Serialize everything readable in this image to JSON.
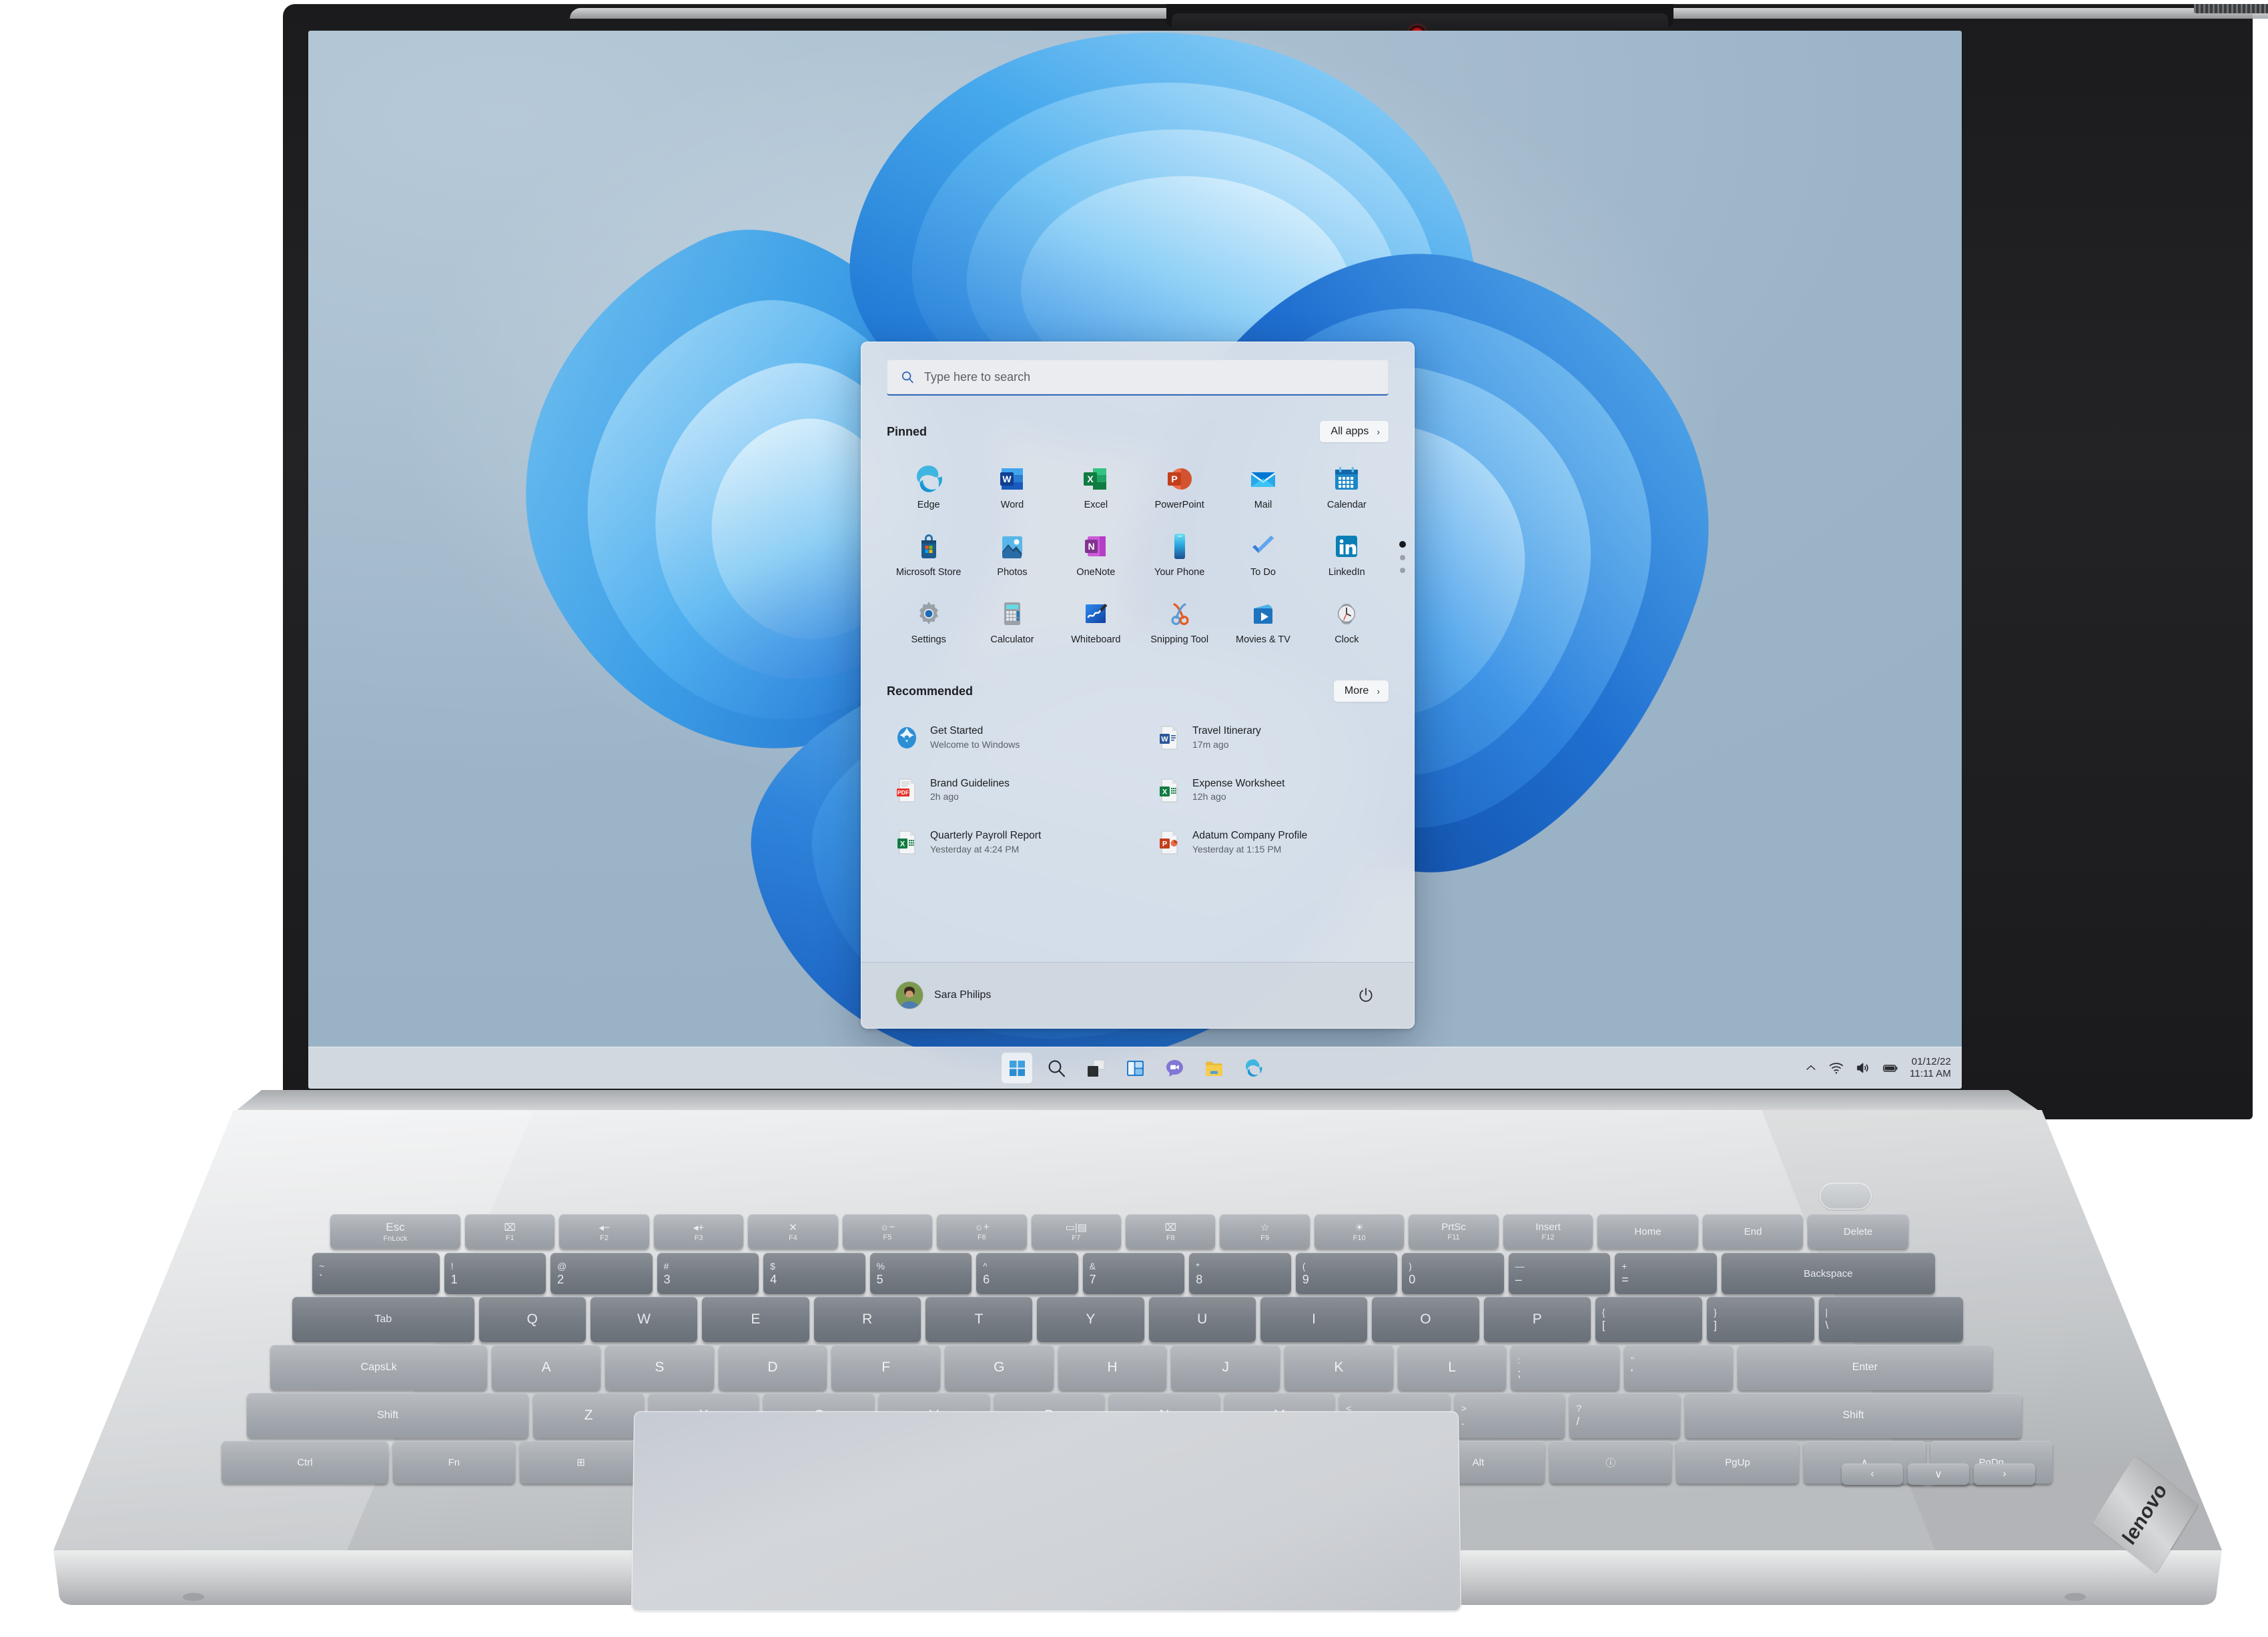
{
  "device": {
    "brand": "lenovo",
    "camera_icon": "webcam-icon"
  },
  "desktop": {
    "wallpaper_name": "windows-11-bloom"
  },
  "start_menu": {
    "search": {
      "placeholder": "Type here to search",
      "value": "",
      "icon": "search-icon"
    },
    "pinned": {
      "title": "Pinned",
      "all_apps_label": "All apps",
      "chevron": "›",
      "pages": {
        "count": 3,
        "current": 1
      },
      "apps": [
        {
          "label": "Edge",
          "icon": "edge-icon"
        },
        {
          "label": "Word",
          "icon": "word-icon"
        },
        {
          "label": "Excel",
          "icon": "excel-icon"
        },
        {
          "label": "PowerPoint",
          "icon": "powerpoint-icon"
        },
        {
          "label": "Mail",
          "icon": "mail-icon"
        },
        {
          "label": "Calendar",
          "icon": "calendar-icon"
        },
        {
          "label": "Microsoft Store",
          "icon": "microsoft-store-icon"
        },
        {
          "label": "Photos",
          "icon": "photos-icon"
        },
        {
          "label": "OneNote",
          "icon": "onenote-icon"
        },
        {
          "label": "Your Phone",
          "icon": "your-phone-icon"
        },
        {
          "label": "To Do",
          "icon": "to-do-icon"
        },
        {
          "label": "LinkedIn",
          "icon": "linkedin-icon"
        },
        {
          "label": "Settings",
          "icon": "settings-gear-icon"
        },
        {
          "label": "Calculator",
          "icon": "calculator-icon"
        },
        {
          "label": "Whiteboard",
          "icon": "whiteboard-icon"
        },
        {
          "label": "Snipping Tool",
          "icon": "snipping-tool-icon"
        },
        {
          "label": "Movies & TV",
          "icon": "movies-tv-icon"
        },
        {
          "label": "Clock",
          "icon": "clock-icon"
        }
      ]
    },
    "recommended": {
      "title": "Recommended",
      "more_label": "More",
      "chevron": "›",
      "items": [
        {
          "title": "Get Started",
          "subtitle": "Welcome to Windows",
          "icon": "get-started-icon"
        },
        {
          "title": "Travel Itinerary",
          "subtitle": "17m ago",
          "icon": "word-doc-icon"
        },
        {
          "title": "Brand Guidelines",
          "subtitle": "2h ago",
          "icon": "pdf-doc-icon"
        },
        {
          "title": "Expense Worksheet",
          "subtitle": "12h ago",
          "icon": "excel-doc-icon"
        },
        {
          "title": "Quarterly Payroll Report",
          "subtitle": "Yesterday at 4:24 PM",
          "icon": "excel-doc-icon"
        },
        {
          "title": "Adatum Company Profile",
          "subtitle": "Yesterday at 1:15 PM",
          "icon": "powerpoint-doc-icon"
        }
      ]
    },
    "footer": {
      "user_name": "Sara Philips",
      "avatar": "user-avatar",
      "power_icon": "power-icon"
    }
  },
  "taskbar": {
    "buttons": [
      {
        "name": "start-button",
        "icon": "windows-logo-icon",
        "active": true
      },
      {
        "name": "search-button",
        "icon": "search-icon",
        "active": false
      },
      {
        "name": "task-view-button",
        "icon": "task-view-icon",
        "active": false
      },
      {
        "name": "widgets-button",
        "icon": "widgets-icon",
        "active": false
      },
      {
        "name": "chat-button",
        "icon": "chat-icon",
        "active": false
      },
      {
        "name": "file-explorer-button",
        "icon": "folder-icon",
        "active": false
      },
      {
        "name": "edge-button",
        "icon": "edge-icon",
        "active": false
      }
    ],
    "tray": {
      "overflow_icon": "chevron-up-icon",
      "wifi_icon": "wifi-icon",
      "volume_icon": "speaker-icon",
      "battery_icon": "battery-icon",
      "date": "01/12/22",
      "time": "11:11 AM"
    }
  },
  "keyboard": {
    "function_row": [
      {
        "top": "Esc",
        "bottom": "FnLock"
      },
      {
        "top": "⌧",
        "bottom": "F1"
      },
      {
        "top": "◂−",
        "bottom": "F2"
      },
      {
        "top": "◂+",
        "bottom": "F3"
      },
      {
        "top": "✕",
        "bottom": "F4"
      },
      {
        "top": "☼−",
        "bottom": "F5"
      },
      {
        "top": "☼+",
        "bottom": "F6"
      },
      {
        "top": "▭|▤",
        "bottom": "F7"
      },
      {
        "top": "⌧",
        "bottom": "F8"
      },
      {
        "top": "☆",
        "bottom": "F9"
      },
      {
        "top": "☀",
        "bottom": "F10"
      },
      {
        "top": "PrtSc",
        "bottom": "F11"
      },
      {
        "top": "Insert",
        "bottom": "F12"
      },
      {
        "top": "Home",
        "bottom": ""
      },
      {
        "top": "End",
        "bottom": ""
      },
      {
        "top": "Delete",
        "bottom": ""
      }
    ],
    "number_row": [
      {
        "up": "~",
        "low": "`"
      },
      {
        "up": "!",
        "low": "1"
      },
      {
        "up": "@",
        "low": "2"
      },
      {
        "up": "#",
        "low": "3"
      },
      {
        "up": "$",
        "low": "4"
      },
      {
        "up": "%",
        "low": "5"
      },
      {
        "up": "^",
        "low": "6"
      },
      {
        "up": "&",
        "low": "7"
      },
      {
        "up": "*",
        "low": "8"
      },
      {
        "up": "(",
        "low": "9"
      },
      {
        "up": ")",
        "low": "0"
      },
      {
        "up": "—",
        "low": "–"
      },
      {
        "up": "+",
        "low": "="
      },
      {
        "up": "",
        "low": "Backspace"
      }
    ],
    "row_q": [
      "Tab",
      "Q",
      "W",
      "E",
      "R",
      "T",
      "Y",
      "U",
      "I",
      "O",
      "P",
      "{ [",
      "} ]",
      "| \\"
    ],
    "row_a": [
      "CapsLk",
      "A",
      "S",
      "D",
      "F",
      "G",
      "H",
      "J",
      "K",
      "L",
      ": ;",
      "\" '",
      "Enter"
    ],
    "row_z": [
      "Shift",
      "Z",
      "X",
      "C",
      "V",
      "B",
      "N",
      "M",
      "< ,",
      "> .",
      "? /",
      "Shift"
    ],
    "row_ctrl": [
      "Ctrl",
      "Fn",
      "⊞",
      "Alt",
      "",
      "Alt",
      "ⓘ",
      "PgUp",
      "∧",
      "PgDn"
    ],
    "arrow_keys": [
      "‹",
      "∨",
      "›"
    ]
  }
}
